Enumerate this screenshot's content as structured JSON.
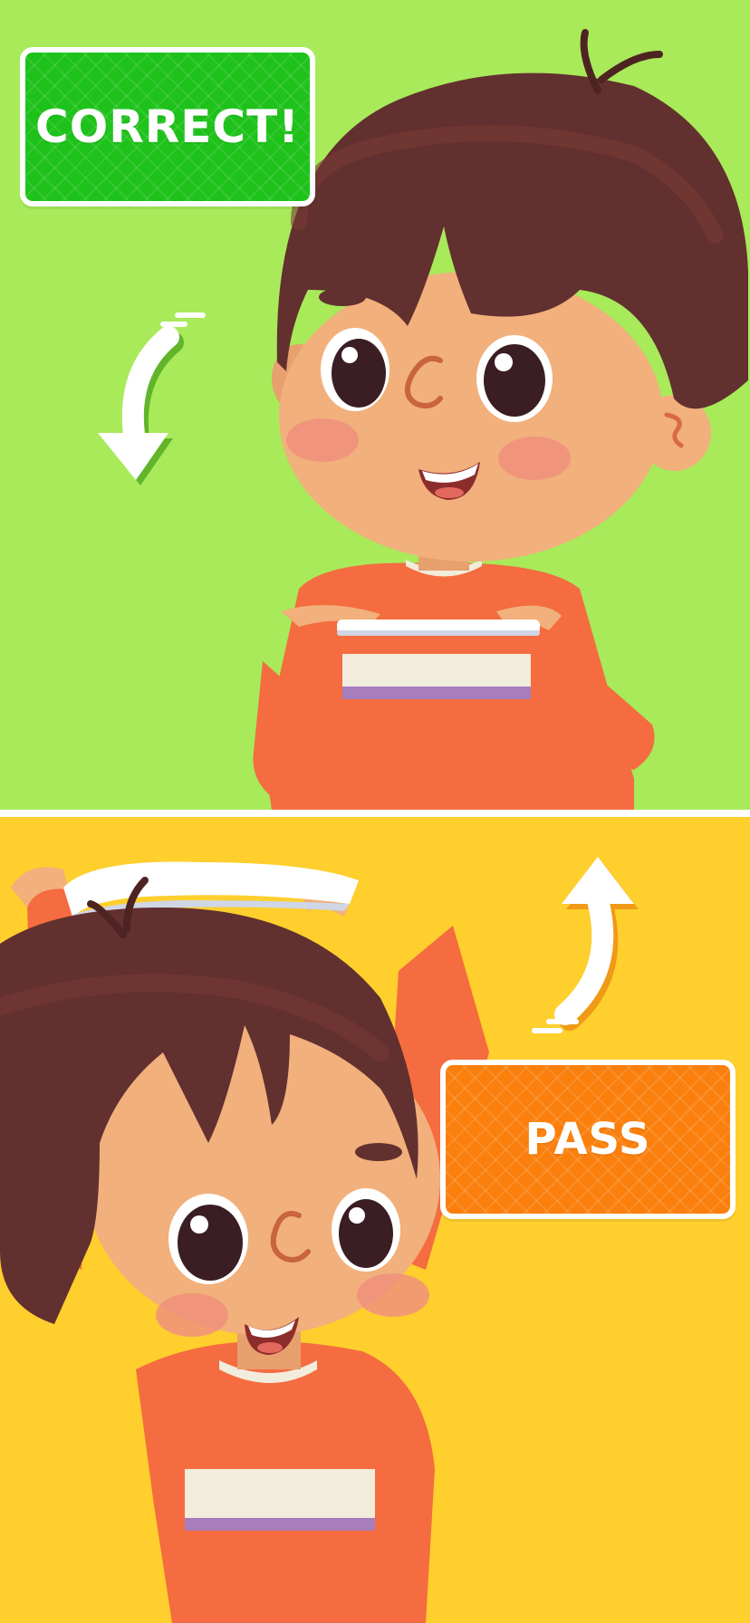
{
  "colors": {
    "correct_background": "#a8ea5a",
    "pass_background": "#fecf2d",
    "correct_badge": "#1ec21a",
    "pass_badge": "#fa7f0c",
    "divider": "#ffffff",
    "hair": "#62302f",
    "skin": "#f1b07c",
    "shirt": "#f46c3f"
  },
  "badges": {
    "correct_label": "CORRECT!",
    "pass_label": "PASS"
  },
  "icons": {
    "correct_arrow": "arrow-down-curved-icon",
    "pass_arrow": "arrow-up-curved-icon"
  }
}
